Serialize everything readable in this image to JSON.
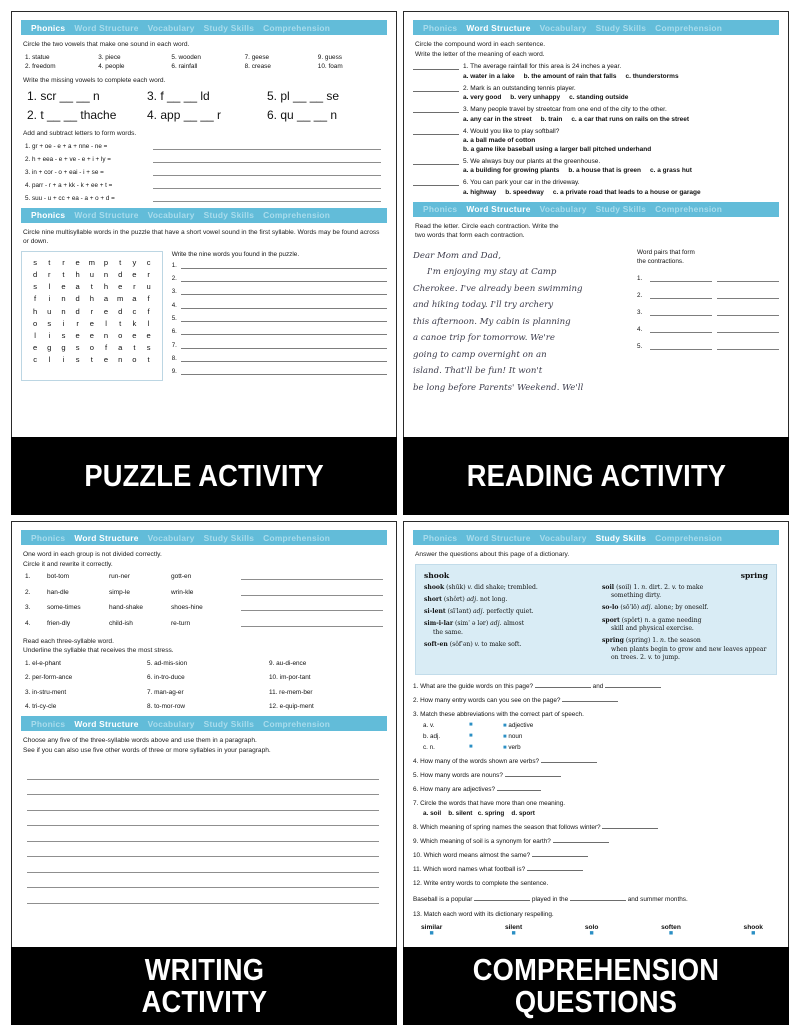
{
  "tabs": [
    "Phonics",
    "Word Structure",
    "Vocabulary",
    "Study Skills",
    "Comprehension"
  ],
  "panels": {
    "puzzle": {
      "caption_lines": [
        "PUZZLE ACTIVITY"
      ],
      "section1": {
        "active_tab": "Phonics",
        "instruction": "Circle the two vowels that make one sound in each word.",
        "words": [
          "1. statue",
          "2. freedom",
          "3. piece",
          "4. people",
          "5. wooden",
          "6. rainfall",
          "7. geese",
          "8. crease",
          "9. guess",
          "10. foam"
        ],
        "instruction2": "Write the missing vowels to complete each word.",
        "blanks": [
          "1. scr __ __ n",
          "2. t __ __ thache",
          "3. f __ __ ld",
          "4. app __ __ r",
          "5. pl __ __ se",
          "6. qu __ __ n"
        ],
        "instruction3": "Add and subtract letters to form words.",
        "equations": [
          "1. gr + oe - e + a + nne - ne =",
          "2. h + eea - e + ve - e + i + ly =",
          "3. in + cor - o + eai - i + se =",
          "4. parr - r + a + kk - k + ee + t =",
          "5. suu - u + cc + ea - a + o + d ="
        ]
      },
      "section2": {
        "active_tab": "Phonics",
        "instruction": "Circle nine multisyllable words in the puzzle that have a short vowel sound in the first syllable. Words may be found across or down.",
        "grid": [
          "s t r e m p t y c",
          "d r t h u n d e r",
          "s l e a t h e r u",
          "f i n d h a m a f",
          "h u n d r e d c f",
          "o s i r e l t k l",
          "l i s e e n o e e",
          "e g g s o f a t s",
          "c l i s t e n o t"
        ],
        "answers_head": "Write the nine words you found in the puzzle.",
        "answer_numbers": [
          "1.",
          "2.",
          "3.",
          "4.",
          "5.",
          "6.",
          "7.",
          "8.",
          "9."
        ]
      }
    },
    "reading": {
      "caption_lines": [
        "READING ACTIVITY"
      ],
      "section1": {
        "active_tab": "Word Structure",
        "instruction": "Circle the compound word in each sentence.\nWrite the letter of the meaning of each word.",
        "questions": [
          {
            "num": "1.",
            "text": "The average rainfall for this area is 24 inches a year.",
            "choices": [
              "a. water in a lake",
              "b. the amount of rain that falls",
              "c. thunderstorms"
            ],
            "stacked": false
          },
          {
            "num": "2.",
            "text": "Mark is an outstanding tennis player.",
            "choices": [
              "a. very good",
              "b. very unhappy",
              "c. standing outside"
            ],
            "stacked": false
          },
          {
            "num": "3.",
            "text": "Many people travel by streetcar from one end of the city to the other.",
            "choices": [
              "a. any car in the street",
              "b. train",
              "c. a car that runs on rails on the street"
            ],
            "stacked": false
          },
          {
            "num": "4.",
            "text": "Would you like to play softball?",
            "choices": [
              "a. a ball made of cotton",
              "b. a game like baseball using a larger ball pitched underhand"
            ],
            "stacked": true
          },
          {
            "num": "5.",
            "text": "We always buy our plants at the greenhouse.",
            "choices": [
              "a. a building for growing plants",
              "b. a house that is green",
              "c. a grass hut"
            ],
            "stacked": false
          },
          {
            "num": "6.",
            "text": "You can park your car in the driveway.",
            "choices": [
              "a. highway",
              "b. speedway",
              "c. a private road that leads to a house or garage"
            ],
            "stacked": false
          }
        ]
      },
      "section2": {
        "active_tab": "Word Structure",
        "instruction": "Read the letter. Circle each contraction. Write the\ntwo words that form each contraction.",
        "letter_lines": [
          "Dear Mom and Dad,",
          "I'm enjoying my stay at Camp",
          "Cherokee. I've already been swimming",
          "and hiking today. I'll try archery",
          "this afternoon. My cabin is planning",
          "a canoe trip for tomorrow. We're",
          "going to camp overnight on an",
          "island. That'll be fun! It won't",
          "be long before Parents' Weekend. We'll"
        ],
        "pairs_head": "Word pairs that form\nthe contractions.",
        "pair_numbers": [
          "1.",
          "2.",
          "3.",
          "4.",
          "5."
        ]
      }
    },
    "writing": {
      "caption_lines": [
        "WRITING",
        "ACTIVITY"
      ],
      "section1": {
        "active_tab": "Word Structure",
        "instruction": "One word in each group is not divided correctly.\nCircle it and rewrite it correctly.",
        "rows": [
          [
            "1.",
            "bot-tom",
            "run-ner",
            "gott-en"
          ],
          [
            "2.",
            "han-dle",
            "simp-le",
            "wrin-kle"
          ],
          [
            "3.",
            "some-times",
            "hand-shake",
            "shoes-hine"
          ],
          [
            "4.",
            "frien-dly",
            "child-ish",
            "re-turn"
          ]
        ],
        "instruction2": "Read each three-syllable word.\nUnderline the syllable that receives the most stress.",
        "syllable_words": [
          "1. el-e-phant",
          "5. ad-mis-sion",
          "9. au-di-ence",
          "2. per-form-ance",
          "6. in-tro-duce",
          "10. im-por-tant",
          "3. in-stru-ment",
          "7. man-ag-er",
          "11. re-mem-ber",
          "4. tri-cy-cle",
          "8. to-mor-row",
          "12. e-quip-ment"
        ]
      },
      "section2": {
        "active_tab": "Word Structure",
        "instruction": "Choose any five of the three-syllable words above and use them in a paragraph.\nSee if you can also use five other words of three or more syllables in your paragraph.",
        "line_count": 9
      }
    },
    "comprehension": {
      "caption_lines": [
        "COMPREHENSION",
        "QUESTIONS"
      ],
      "section1": {
        "active_tab": "Study Skills",
        "instruction": "Answer the questions about this page of a dictionary.",
        "dictionary": {
          "guide_left": "shook",
          "guide_right": "spring",
          "left_entries": [
            {
              "word": "shook",
              "rest": " (shūk) <i>v.</i> did shake; trembled."
            },
            {
              "word": "short",
              "rest": " (shôrt) <i>adj.</i> not long."
            },
            {
              "word": "si-lent",
              "rest": " (sīˈlənt) <i>adj.</i> perfectly quiet."
            },
            {
              "word": "sim-i-lar",
              "rest": " (simˈ ə lər) <i>adj.</i> almost",
              "hang": "the same."
            },
            {
              "word": "soft-en",
              "rest": " (sôfˈən) <i>v.</i> to make soft."
            }
          ],
          "right_entries": [
            {
              "word": "soil",
              "rest": " (soil) 1. <i>n.</i> dirt. 2. <i>v.</i> to make",
              "hang": "something dirty."
            },
            {
              "word": "so-lo",
              "rest": " (sōˈlō) <i>adj.</i> alone; by oneself."
            },
            {
              "word": "sport",
              "rest": " (spôrt) <i>n.</i> a game needing",
              "hang": "skill and physical exercise."
            },
            {
              "word": "spring",
              "rest": " (spring) 1. <i>n.</i> the season",
              "hang": "when plants begin to grow and new leaves appear on trees. 2. <i>v.</i> to jump."
            }
          ]
        },
        "questions": [
          "1. What are the guide words on this page?",
          "2. How many entry words can you see on the page?",
          "3. Match these abbreviations with the correct part of speech.",
          "4. How many of the words shown are verbs?",
          "5. How many words are nouns?",
          "6. How many are adjectives?",
          "7. Circle the words that have more than one meaning.",
          "8. Which meaning of spring names the season that follows winter?",
          "9. Which meaning of soil is a synonym for earth?",
          "10. Which word means almost the same?",
          "11. Which word names what football is?",
          "12. Write entry words to complete the sentence.",
          "13. Match each word with its dictionary respelling."
        ],
        "match_abbrev": [
          "a. v.",
          "b. adj.",
          "c. n."
        ],
        "match_parts": [
          "adjective",
          "noun",
          "verb"
        ],
        "q7_choices": "a. soil    b. silent   c. spring    d. sport",
        "q12_sentence_a": "Baseball is a popular",
        "q12_sentence_b": "played in the",
        "q12_sentence_c": "and summer months.",
        "match_words": [
          "similar",
          "silent",
          "solo",
          "soften",
          "shook"
        ]
      }
    }
  },
  "colors": {
    "tabbar": "#62bcd9",
    "tab_active": "#ffffff",
    "tab_inactive": "#a9dcec",
    "dict_bg": "#d9ecf5",
    "caption_bg": "#000000",
    "accent_dot": "#2b8fc4"
  }
}
